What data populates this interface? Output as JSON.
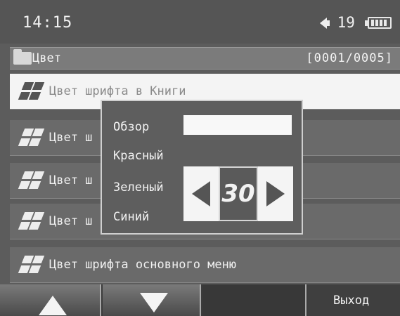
{
  "status": {
    "time": "14:15",
    "volume": "19",
    "icons": [
      "speaker-icon",
      "battery-icon"
    ]
  },
  "header": {
    "title": "Цвет",
    "counter": "[0001/0005]",
    "icon": "folder-icon"
  },
  "list": {
    "items": [
      {
        "label": "Цвет шрифта в Книги",
        "selected": true
      },
      {
        "label": "Цвет ш"
      },
      {
        "label": "Цвет ш"
      },
      {
        "label": "Цвет ш"
      },
      {
        "label": "Цвет шрифта основного меню"
      }
    ],
    "item_icon": "color-grid-icon"
  },
  "dialog": {
    "preview_label": "Обзор",
    "red_label": "Красный",
    "green_label": "Зеленый",
    "blue_label": "Синий",
    "value": "30",
    "icons": [
      "arrow-left-icon",
      "arrow-right-icon"
    ]
  },
  "softkeys": {
    "up_icon": "arrow-up-icon",
    "down_icon": "arrow-down-icon",
    "exit_label": "Выход"
  },
  "colors": {
    "background": "#5c5c5c",
    "selected_row": "#f4f4f4",
    "text": "#f2f2f2"
  }
}
